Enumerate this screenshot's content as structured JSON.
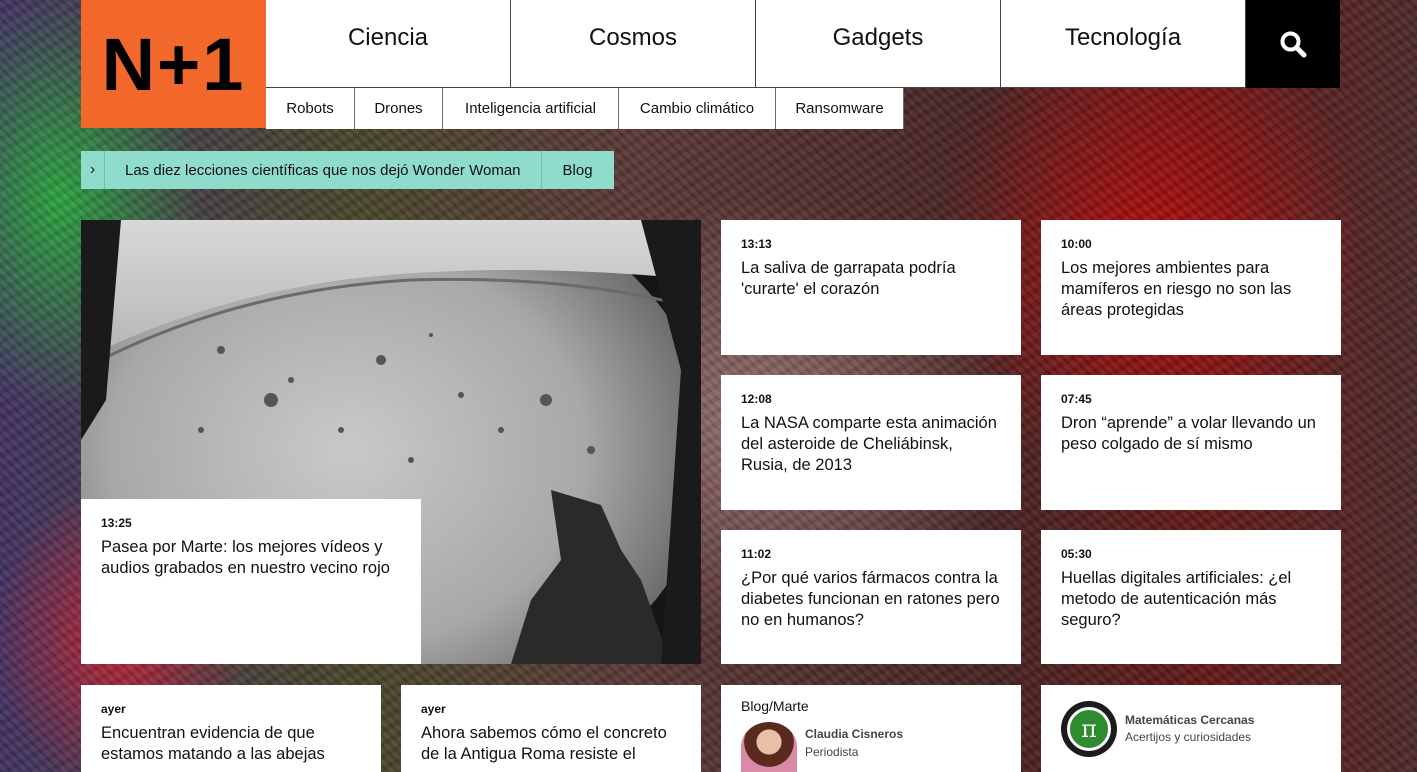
{
  "header": {
    "logo_text": "N+1",
    "main_nav": [
      "Ciencia",
      "Cosmos",
      "Gadgets",
      "Tecnología"
    ],
    "sub_nav": [
      "Robots",
      "Drones",
      "Inteligencia artificial",
      "Cambio climático",
      "Ransomware"
    ]
  },
  "ticker": {
    "arrow": "›",
    "text": "Las diez lecciones científicas que nos dejó Wonder Woman",
    "tag": "Blog"
  },
  "hero": {
    "time": "13:25",
    "title": "Pasea por Marte: los mejores vídeos y audios grabados en nuestro vecino rojo"
  },
  "news": [
    {
      "time": "13:13",
      "title": "La saliva de garrapata podría 'curarte' el corazón"
    },
    {
      "time": "10:00",
      "title": "Los mejores ambientes para mamíferos en riesgo no son las áreas protegidas"
    },
    {
      "time": "12:08",
      "title": "La NASA comparte esta animación del asteroide de Cheliábinsk, Rusia, de 2013"
    },
    {
      "time": "07:45",
      "title": "Dron “aprende” a volar llevando un peso colgado de sí mismo"
    },
    {
      "time": "11:02",
      "title": "¿Por qué varios fármacos contra la diabetes funcionan en ratones pero no en humanos?"
    },
    {
      "time": "05:30",
      "title": "Huellas digitales artificiales: ¿el metodo de autenticación más seguro?"
    }
  ],
  "bottom": [
    {
      "time": "ayer",
      "title": "Encuentran evidencia de que estamos matando a las abejas"
    },
    {
      "time": "ayer",
      "title": "Ahora sabemos cómo el concreto de la Antigua Roma resiste el"
    }
  ],
  "blog": {
    "label": "Blog/Marte",
    "author_name": "Claudia Cisneros",
    "author_role": "Periodista"
  },
  "math": {
    "symbol": "π",
    "name": "Matemáticas Cercanas",
    "desc": "Acertijos y curiosidades"
  },
  "colors": {
    "logo": "#f2672a",
    "ticker": "#8fdccd",
    "search_bg": "#000000"
  },
  "icons": {
    "search": "search-icon",
    "chevron": "chevron-right-icon"
  }
}
